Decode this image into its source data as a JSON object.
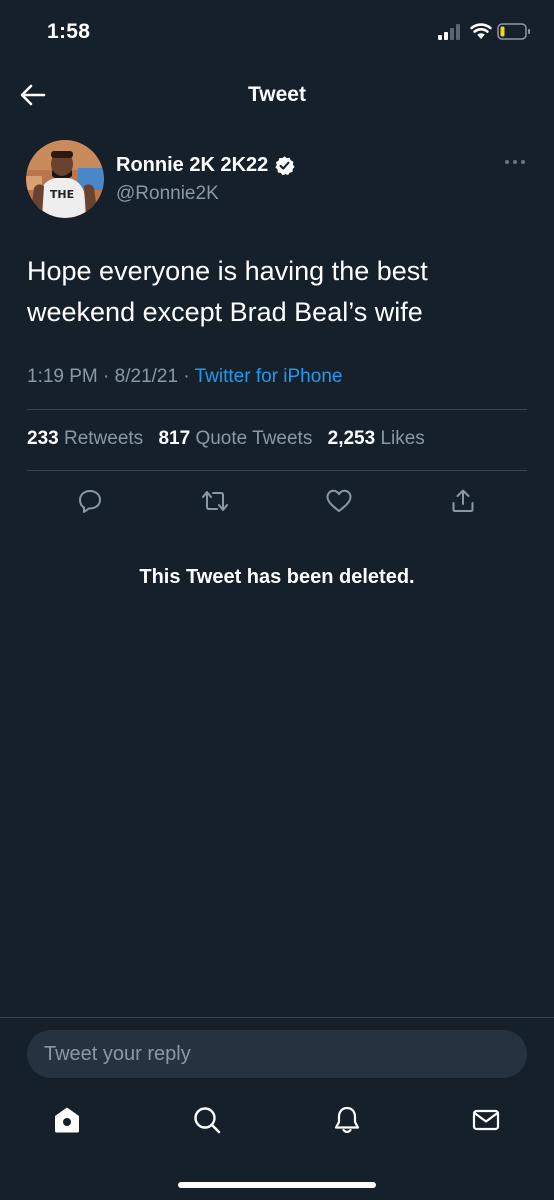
{
  "status_bar": {
    "time": "1:58"
  },
  "header": {
    "title": "Tweet",
    "back_icon": "arrow-left-icon"
  },
  "tweet": {
    "author_name": "Ronnie 2K 2K22",
    "author_handle": "@Ronnie2K",
    "verified": true,
    "text": "Hope everyone is having the best weekend except Brad Beal’s wife",
    "time": "1:19 PM",
    "date": "8/21/21",
    "separator": "·",
    "source": "Twitter for iPhone",
    "avatar_shirt_text": "THE"
  },
  "stats": {
    "retweets_count": "233",
    "retweets_label": "Retweets",
    "quotes_count": "817",
    "quotes_label": "Quote Tweets",
    "likes_count": "2,253",
    "likes_label": "Likes"
  },
  "actions": [
    "reply-icon",
    "retweet-icon",
    "like-icon",
    "share-icon"
  ],
  "deleted_message": "This Tweet has been deleted.",
  "reply": {
    "placeholder": "Tweet your reply"
  },
  "tab_bar": {
    "items": [
      "home-icon",
      "search-icon",
      "notifications-icon",
      "messages-icon"
    ]
  },
  "colors": {
    "background": "#15202b",
    "accent": "#1d9bf0",
    "secondary_text": "#8b98a5",
    "divider": "#38444d"
  }
}
